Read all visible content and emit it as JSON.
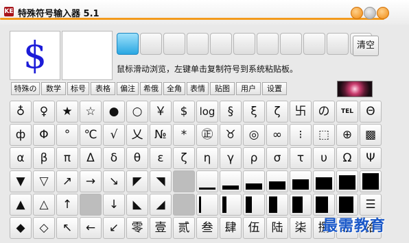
{
  "window": {
    "title": "特殊符号输入器 5.1",
    "icon_text": "KE"
  },
  "preview": {
    "symbol": "$"
  },
  "history_slots": 11,
  "toolbar": {
    "clear_label": "清空",
    "hint": "鼠标滑动浏览，左键单击复制符号到系统粘贴板。"
  },
  "tabs": [
    "特殊の",
    "数学",
    "标号",
    "表格",
    "偏注",
    "希俄",
    "全角",
    "表情",
    "贴图",
    "用户",
    "设置"
  ],
  "grid_rows": [
    [
      "♁",
      "♀",
      "★",
      "☆",
      "●",
      "○",
      "￥",
      "$",
      "log",
      "§",
      "ξ",
      "ζ",
      "卐",
      "の",
      "TEL",
      "Θ"
    ],
    [
      "ф",
      "Φ",
      "°",
      "℃",
      "√",
      "乂",
      "№",
      "*",
      "㊣",
      "♉",
      "◎",
      "∞",
      "⁝",
      "⬚",
      "⊕",
      "▩"
    ],
    [
      "α",
      "β",
      "π",
      "Δ",
      "δ",
      "θ",
      "ε",
      "ζ",
      "η",
      "γ",
      "ρ",
      "σ",
      "τ",
      "υ",
      "Ω",
      "Ψ"
    ],
    [
      "▼",
      "▽",
      "↗",
      "→",
      "↘",
      "◤",
      "◥",
      "",
      "▁",
      "▂",
      "▃",
      "▄",
      "▅",
      "▆",
      "▇",
      "█"
    ],
    [
      "▲",
      "△",
      "↑",
      "",
      "↓",
      "◣",
      "◢",
      "",
      "▏",
      "▎",
      "▍",
      "▌",
      "▋",
      "▊",
      "▉",
      "☰"
    ],
    [
      "◆",
      "◇",
      "↖",
      "←",
      "↙",
      "零",
      "壹",
      "贰",
      "叁",
      "肆",
      "伍",
      "陆",
      "柒",
      "捌",
      "玖",
      "拾"
    ]
  ],
  "watermark": "最需教育"
}
